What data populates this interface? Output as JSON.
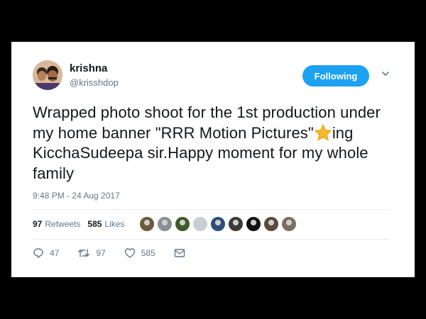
{
  "tweet": {
    "author": {
      "name": "krishna",
      "handle": "@krisshdop"
    },
    "follow_button_label": "Following",
    "text_before_emoji": "Wrapped photo shoot for the 1st production under my home banner \"RRR Motion Pictures\"",
    "emoji": "star",
    "text_after_emoji": "ing KicchaSudeepa sir.Happy moment for my whole family",
    "timestamp": "9:48 PM - 24 Aug 2017",
    "stats": {
      "retweets_count": "97",
      "retweets_label": "Retweets",
      "likes_count": "585",
      "likes_label": "Likes"
    },
    "likers": [
      {
        "color": "#6b5a3e"
      },
      {
        "color": "#8a8f94"
      },
      {
        "color": "#3d5a2a"
      },
      {
        "color": "#c7ced6"
      },
      {
        "color": "#2d4f7a"
      },
      {
        "color": "#3a3a3a"
      },
      {
        "color": "#111111"
      },
      {
        "color": "#5a4a3a"
      },
      {
        "color": "#7a7060"
      }
    ],
    "actions": {
      "replies": "47",
      "retweets": "97",
      "likes": "585"
    }
  },
  "colors": {
    "accent": "#1da1f2",
    "text": "#14171a",
    "muted": "#657786",
    "star": "#f5b82e"
  }
}
